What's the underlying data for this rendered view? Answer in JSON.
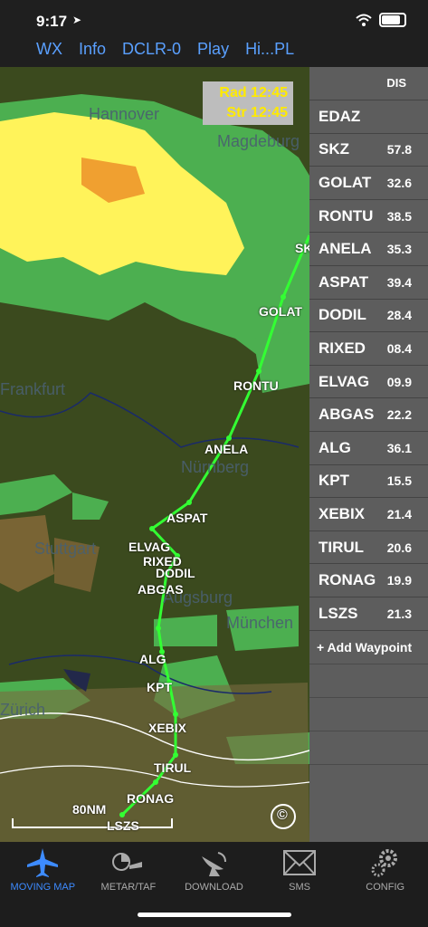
{
  "status": {
    "time": "9:17"
  },
  "nav": {
    "wx": "WX",
    "info": "Info",
    "dclr": "DCLR-0",
    "play": "Play",
    "hipl": "Hi...PL"
  },
  "radar": {
    "rad": "Rad 12:45",
    "str": "Str 12:45"
  },
  "map": {
    "cities": [
      "Hannover",
      "Magdeburg",
      "Frankfurt",
      "Nürnberg",
      "Stuttgart",
      "Augsburg",
      "München",
      "Zürich"
    ],
    "scale": "80NM",
    "copyright": "©",
    "waypoint_labels": [
      "SKZ",
      "GOLAT",
      "RONTU",
      "ANELA",
      "ASPAT",
      "ELVAG",
      "RIXED",
      "DODIL",
      "ABGAS",
      "ALG",
      "KPT",
      "XEBIX",
      "TIRUL",
      "RONAG",
      "LSZS"
    ]
  },
  "sidebar": {
    "header": "DIS",
    "waypoints": [
      {
        "name": "EDAZ",
        "dist": ""
      },
      {
        "name": "SKZ",
        "dist": "57.8"
      },
      {
        "name": "GOLAT",
        "dist": "32.6"
      },
      {
        "name": "RONTU",
        "dist": "38.5"
      },
      {
        "name": "ANELA",
        "dist": "35.3"
      },
      {
        "name": "ASPAT",
        "dist": "39.4"
      },
      {
        "name": "DODIL",
        "dist": "28.4"
      },
      {
        "name": "RIXED",
        "dist": "08.4"
      },
      {
        "name": "ELVAG",
        "dist": "09.9"
      },
      {
        "name": "ABGAS",
        "dist": "22.2"
      },
      {
        "name": "ALG",
        "dist": "36.1"
      },
      {
        "name": "KPT",
        "dist": "15.5"
      },
      {
        "name": "XEBIX",
        "dist": "21.4"
      },
      {
        "name": "TIRUL",
        "dist": "20.6"
      },
      {
        "name": "RONAG",
        "dist": "19.9"
      },
      {
        "name": "LSZS",
        "dist": "21.3"
      }
    ],
    "add_waypoint": "+ Add Waypoint"
  },
  "tabs": [
    {
      "label": "MOVING MAP",
      "icon": "airplane-icon"
    },
    {
      "label": "METAR/TAF",
      "icon": "windsock-icon"
    },
    {
      "label": "DOWNLOAD",
      "icon": "satellite-dish-icon"
    },
    {
      "label": "SMS",
      "icon": "envelope-icon"
    },
    {
      "label": "CONFIG",
      "icon": "gear-icon"
    }
  ],
  "colors": {
    "accent": "#3d8bff",
    "route": "#33ff33",
    "radar_light": "#4caf50",
    "radar_heavy": "#ffeb3b"
  }
}
